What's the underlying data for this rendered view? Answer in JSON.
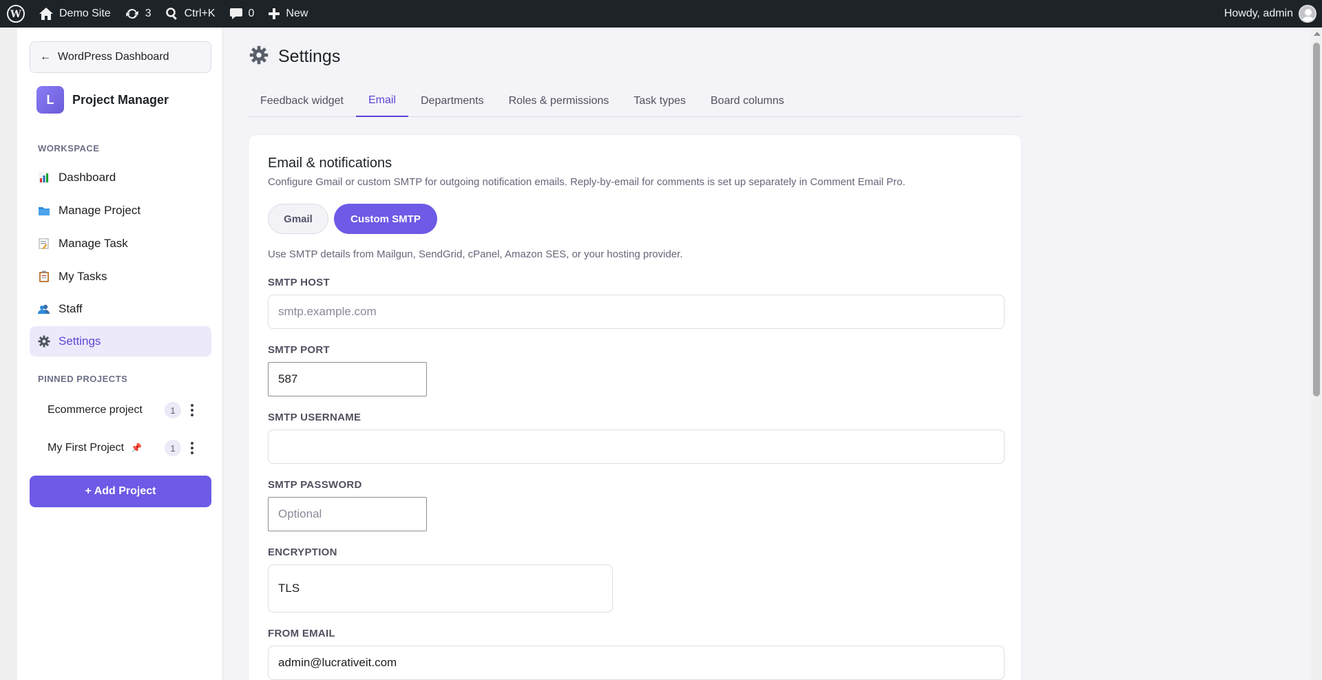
{
  "adminbar": {
    "site_name": "Demo Site",
    "updates_count": "3",
    "search_shortcut": "Ctrl+K",
    "comments_count": "0",
    "new_label": "New",
    "howdy": "Howdy, admin"
  },
  "sidebar": {
    "back_label": "WordPress Dashboard",
    "brand_initial": "L",
    "brand_name": "Project Manager",
    "workspace_label": "WORKSPACE",
    "items": [
      {
        "label": "Dashboard",
        "icon": "bar-chart-icon"
      },
      {
        "label": "Manage Project",
        "icon": "folder-icon"
      },
      {
        "label": "Manage Task",
        "icon": "memo-icon"
      },
      {
        "label": "My Tasks",
        "icon": "clipboard-icon"
      },
      {
        "label": "Staff",
        "icon": "people-icon"
      },
      {
        "label": "Settings",
        "icon": "gear-icon"
      }
    ],
    "pinned_label": "PINNED PROJECTS",
    "pinned": [
      {
        "name": "Ecommerce project",
        "count": "1"
      },
      {
        "name": "My First Project",
        "count": "1"
      }
    ],
    "add_project_label": "+ Add Project"
  },
  "main": {
    "title": "Settings",
    "tabs": [
      {
        "label": "Feedback widget"
      },
      {
        "label": "Email"
      },
      {
        "label": "Departments"
      },
      {
        "label": "Roles & permissions"
      },
      {
        "label": "Task types"
      },
      {
        "label": "Board columns"
      }
    ],
    "active_tab": "Email",
    "card": {
      "title": "Email & notifications",
      "description": "Configure Gmail or custom SMTP for outgoing notification emails. Reply-by-email for comments is set up separately in Comment Email Pro.",
      "gmail_label": "Gmail",
      "smtp_label": "Custom SMTP",
      "hint": "Use SMTP details from Mailgun, SendGrid, cPanel, Amazon SES, or your hosting provider.",
      "fields": {
        "smtp_host": {
          "label": "SMTP HOST",
          "value": "",
          "placeholder": "smtp.example.com"
        },
        "smtp_port": {
          "label": "SMTP PORT",
          "value": "587"
        },
        "smtp_username": {
          "label": "SMTP USERNAME",
          "value": ""
        },
        "smtp_password": {
          "label": "SMTP PASSWORD",
          "value": "",
          "placeholder": "Optional"
        },
        "encryption": {
          "label": "ENCRYPTION",
          "value": "TLS"
        },
        "from_email": {
          "label": "FROM EMAIL",
          "value": "admin@lucrativeit.com"
        }
      }
    }
  },
  "colors": {
    "accent": "#6d5ae6",
    "accent_text": "#5b45d6",
    "adminbar_bg": "#1d2327",
    "active_nav_bg": "#ece9fb"
  }
}
